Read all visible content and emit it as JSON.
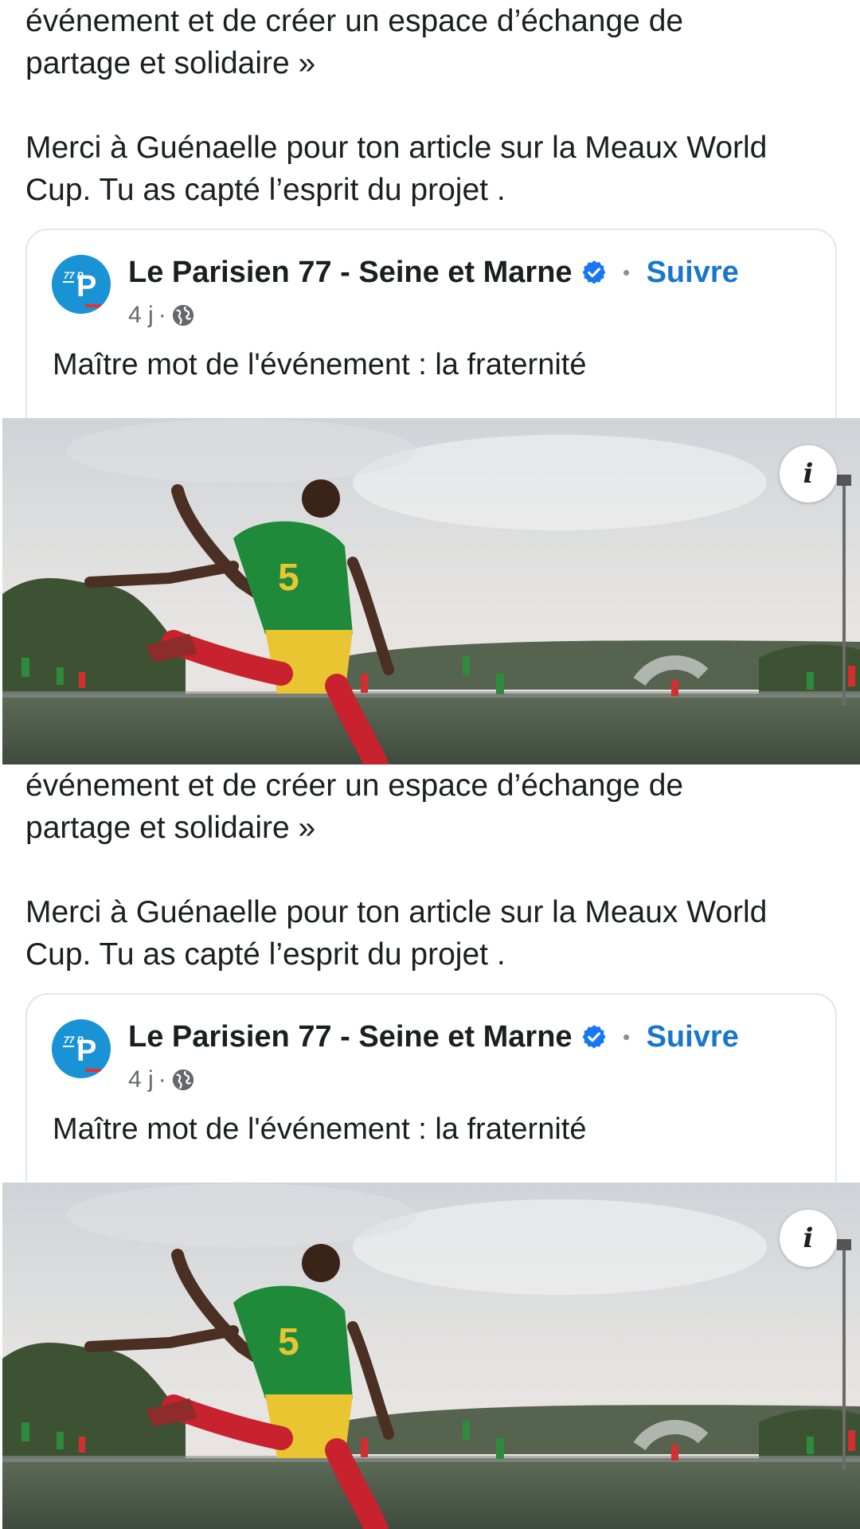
{
  "posts": [
    {
      "text_lines": [
        "événement et de créer un espace d’échange de",
        "partage et solidaire »",
        "",
        "Merci à Guénaelle pour ton article sur la Meaux World",
        "Cup. Tu as capté l’esprit du projet ."
      ],
      "shared": {
        "avatar_letters": "77 P",
        "page_name": "Le Parisien 77 - Seine et Marne",
        "verified_icon": "verified-badge-icon",
        "follow_label": "Suivre",
        "time": "4 j",
        "separator": "·",
        "audience_icon": "globe-icon",
        "text": "Maître mot de l'événement : la fraternité",
        "info_label": "i"
      }
    },
    {
      "text_lines": [
        "événement et de créer un espace d’échange de",
        "partage et solidaire »",
        "",
        "Merci à Guénaelle pour ton article sur la Meaux World",
        "Cup. Tu as capté l’esprit du projet ."
      ],
      "shared": {
        "avatar_letters": "77 P",
        "page_name": "Le Parisien 77 - Seine et Marne",
        "verified_icon": "verified-badge-icon",
        "follow_label": "Suivre",
        "time": "4 j",
        "separator": "·",
        "audience_icon": "globe-icon",
        "text": "Maître mot de l'événement : la fraternité",
        "info_label": "i"
      }
    }
  ],
  "colors": {
    "link_blue": "#1877c9",
    "verified_blue": "#1877f2",
    "avatar_blue": "#1a93d6",
    "text": "#1c1e21",
    "meta": "#65676b"
  }
}
